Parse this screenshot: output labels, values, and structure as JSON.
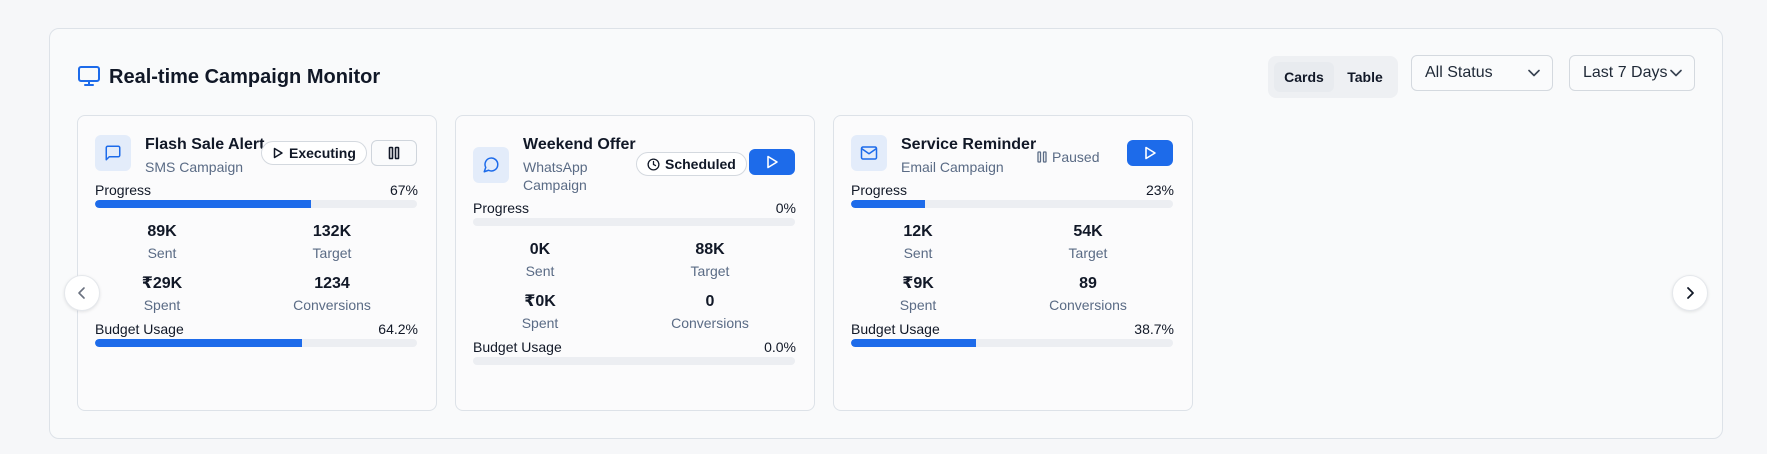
{
  "header": {
    "title": "Real-time Campaign Monitor",
    "icon": "monitor-icon"
  },
  "view_toggle": {
    "options": [
      "Cards",
      "Table"
    ],
    "active": "Cards"
  },
  "filters": {
    "status": "All Status",
    "range": "Last 7 Days"
  },
  "colors": {
    "accent": "#1d6bea",
    "track": "#eceef2",
    "icon_bg": "#e3ecfa",
    "muted": "#5a6b85"
  },
  "labels": {
    "progress": "Progress",
    "budget": "Budget Usage",
    "sent": "Sent",
    "target": "Target",
    "spent": "Spent",
    "conversions": "Conversions"
  },
  "campaigns": [
    {
      "name": "Flash Sale Alert",
      "type": "SMS Campaign",
      "icon": "message-square-icon",
      "status": "Executing",
      "action": "pause",
      "progress_text": "67%",
      "progress": 0.67,
      "sent": "89K",
      "target": "132K",
      "spent": "₹29K",
      "conversions": "1234",
      "budget_text": "64.2%",
      "budget": 0.642
    },
    {
      "name": "Weekend Offer",
      "type": "WhatsApp Campaign",
      "icon": "message-circle-icon",
      "status": "Scheduled",
      "action": "play",
      "progress_text": "0%",
      "progress": 0,
      "sent": "0K",
      "target": "88K",
      "spent": "₹0K",
      "conversions": "0",
      "budget_text": "0.0%",
      "budget": 0
    },
    {
      "name": "Service Reminder",
      "type": "Email Campaign",
      "icon": "mail-icon",
      "status": "Paused",
      "action": "play",
      "progress_text": "23%",
      "progress": 0.23,
      "sent": "12K",
      "target": "54K",
      "spent": "₹9K",
      "conversions": "89",
      "budget_text": "38.7%",
      "budget": 0.387
    }
  ]
}
